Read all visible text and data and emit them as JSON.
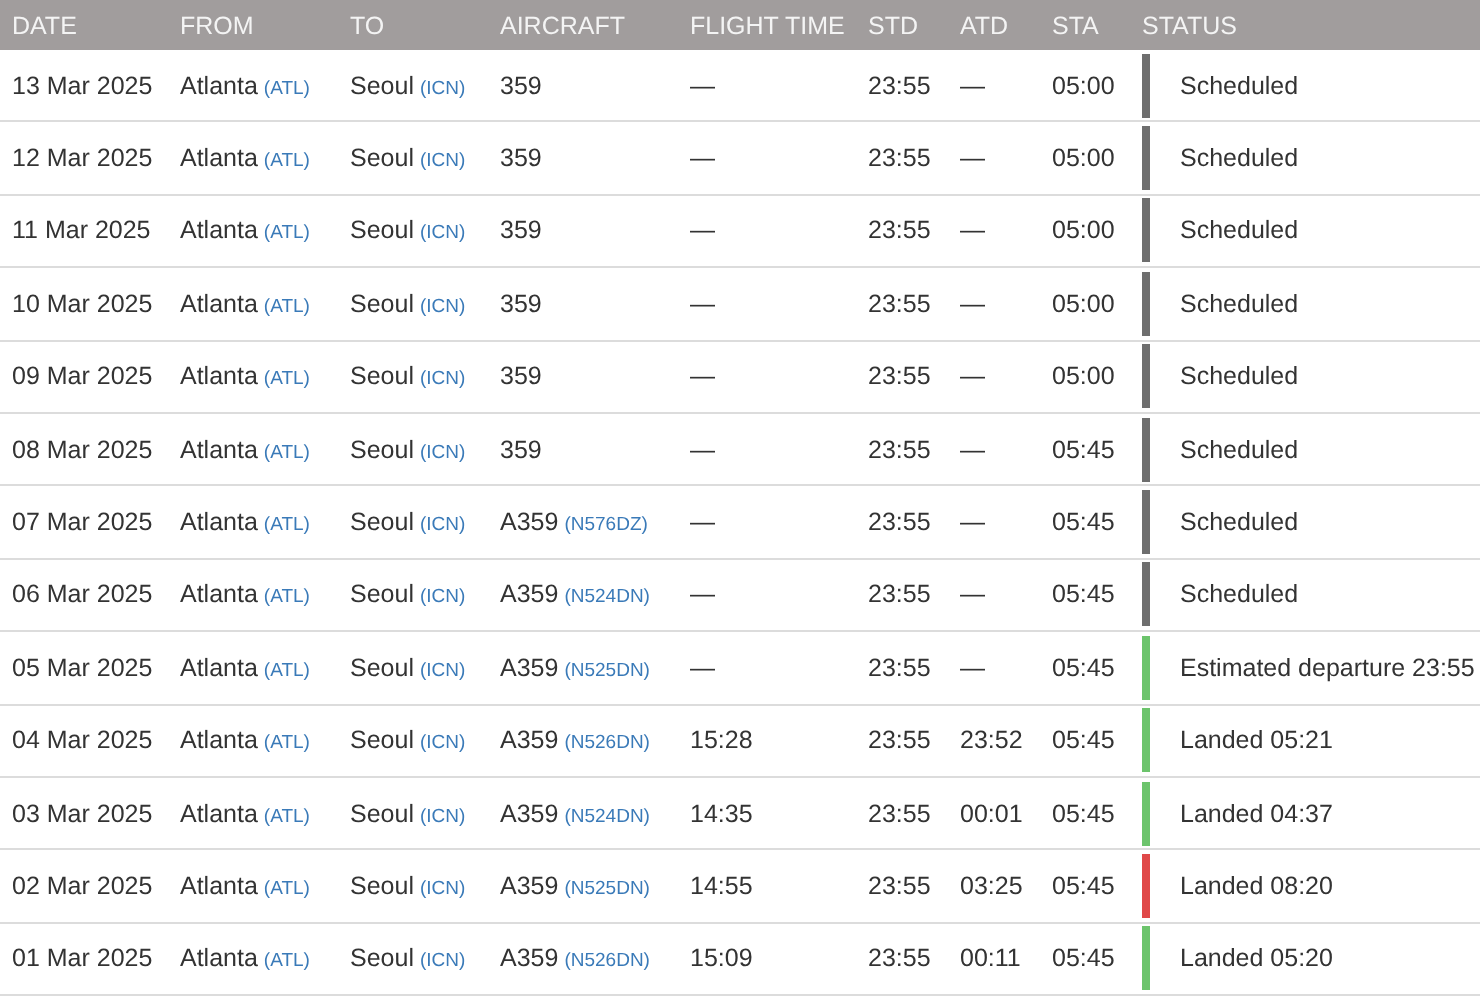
{
  "columns": [
    "DATE",
    "FROM",
    "TO",
    "AIRCRAFT",
    "FLIGHT TIME",
    "STD",
    "ATD",
    "STA",
    "STATUS"
  ],
  "rows": [
    {
      "date": "13 Mar 2025",
      "from": {
        "city": "Atlanta",
        "code": "(ATL)"
      },
      "to": {
        "city": "Seoul",
        "code": "(ICN)"
      },
      "aircraft": {
        "type": "359"
      },
      "flight_time": "—",
      "std": "23:55",
      "atd": "—",
      "sta": "05:00",
      "status": "Scheduled",
      "color": "#6e6e6e"
    },
    {
      "date": "12 Mar 2025",
      "from": {
        "city": "Atlanta",
        "code": "(ATL)"
      },
      "to": {
        "city": "Seoul",
        "code": "(ICN)"
      },
      "aircraft": {
        "type": "359"
      },
      "flight_time": "—",
      "std": "23:55",
      "atd": "—",
      "sta": "05:00",
      "status": "Scheduled",
      "color": "#6e6e6e"
    },
    {
      "date": "11 Mar 2025",
      "from": {
        "city": "Atlanta",
        "code": "(ATL)"
      },
      "to": {
        "city": "Seoul",
        "code": "(ICN)"
      },
      "aircraft": {
        "type": "359"
      },
      "flight_time": "—",
      "std": "23:55",
      "atd": "—",
      "sta": "05:00",
      "status": "Scheduled",
      "color": "#6e6e6e"
    },
    {
      "date": "10 Mar 2025",
      "from": {
        "city": "Atlanta",
        "code": "(ATL)"
      },
      "to": {
        "city": "Seoul",
        "code": "(ICN)"
      },
      "aircraft": {
        "type": "359"
      },
      "flight_time": "—",
      "std": "23:55",
      "atd": "—",
      "sta": "05:00",
      "status": "Scheduled",
      "color": "#6e6e6e"
    },
    {
      "date": "09 Mar 2025",
      "from": {
        "city": "Atlanta",
        "code": "(ATL)"
      },
      "to": {
        "city": "Seoul",
        "code": "(ICN)"
      },
      "aircraft": {
        "type": "359"
      },
      "flight_time": "—",
      "std": "23:55",
      "atd": "—",
      "sta": "05:00",
      "status": "Scheduled",
      "color": "#6e6e6e"
    },
    {
      "date": "08 Mar 2025",
      "from": {
        "city": "Atlanta",
        "code": "(ATL)"
      },
      "to": {
        "city": "Seoul",
        "code": "(ICN)"
      },
      "aircraft": {
        "type": "359"
      },
      "flight_time": "—",
      "std": "23:55",
      "atd": "—",
      "sta": "05:45",
      "status": "Scheduled",
      "color": "#6e6e6e"
    },
    {
      "date": "07 Mar 2025",
      "from": {
        "city": "Atlanta",
        "code": "(ATL)"
      },
      "to": {
        "city": "Seoul",
        "code": "(ICN)"
      },
      "aircraft": {
        "type": "A359",
        "reg": "(N576DZ)"
      },
      "flight_time": "—",
      "std": "23:55",
      "atd": "—",
      "sta": "05:45",
      "status": "Scheduled",
      "color": "#6e6e6e"
    },
    {
      "date": "06 Mar 2025",
      "from": {
        "city": "Atlanta",
        "code": "(ATL)"
      },
      "to": {
        "city": "Seoul",
        "code": "(ICN)"
      },
      "aircraft": {
        "type": "A359",
        "reg": "(N524DN)"
      },
      "flight_time": "—",
      "std": "23:55",
      "atd": "—",
      "sta": "05:45",
      "status": "Scheduled",
      "color": "#6e6e6e"
    },
    {
      "date": "05 Mar 2025",
      "from": {
        "city": "Atlanta",
        "code": "(ATL)"
      },
      "to": {
        "city": "Seoul",
        "code": "(ICN)"
      },
      "aircraft": {
        "type": "A359",
        "reg": "(N525DN)"
      },
      "flight_time": "—",
      "std": "23:55",
      "atd": "—",
      "sta": "05:45",
      "status": "Estimated departure 23:55",
      "color": "#6cc46c"
    },
    {
      "date": "04 Mar 2025",
      "from": {
        "city": "Atlanta",
        "code": "(ATL)"
      },
      "to": {
        "city": "Seoul",
        "code": "(ICN)"
      },
      "aircraft": {
        "type": "A359",
        "reg": "(N526DN)"
      },
      "flight_time": "15:28",
      "std": "23:55",
      "atd": "23:52",
      "sta": "05:45",
      "status": "Landed 05:21",
      "color": "#6cc46c"
    },
    {
      "date": "03 Mar 2025",
      "from": {
        "city": "Atlanta",
        "code": "(ATL)"
      },
      "to": {
        "city": "Seoul",
        "code": "(ICN)"
      },
      "aircraft": {
        "type": "A359",
        "reg": "(N524DN)"
      },
      "flight_time": "14:35",
      "std": "23:55",
      "atd": "00:01",
      "sta": "05:45",
      "status": "Landed 04:37",
      "color": "#6cc46c"
    },
    {
      "date": "02 Mar 2025",
      "from": {
        "city": "Atlanta",
        "code": "(ATL)"
      },
      "to": {
        "city": "Seoul",
        "code": "(ICN)"
      },
      "aircraft": {
        "type": "A359",
        "reg": "(N525DN)"
      },
      "flight_time": "14:55",
      "std": "23:55",
      "atd": "03:25",
      "sta": "05:45",
      "status": "Landed 08:20",
      "color": "#e04848"
    },
    {
      "date": "01 Mar 2025",
      "from": {
        "city": "Atlanta",
        "code": "(ATL)"
      },
      "to": {
        "city": "Seoul",
        "code": "(ICN)"
      },
      "aircraft": {
        "type": "A359",
        "reg": "(N526DN)"
      },
      "flight_time": "15:09",
      "std": "23:55",
      "atd": "00:11",
      "sta": "05:45",
      "status": "Landed 05:20",
      "color": "#6cc46c"
    }
  ]
}
